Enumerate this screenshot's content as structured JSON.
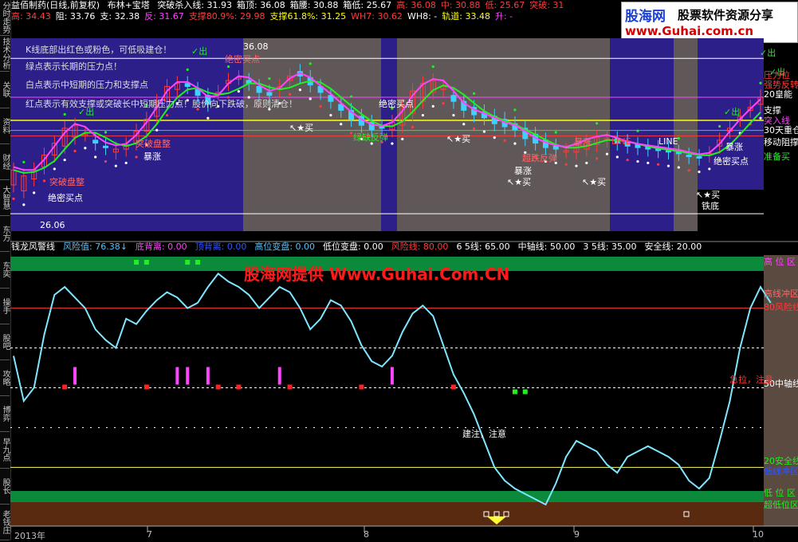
{
  "left_tabs": [
    "分时走势",
    "技术分析",
    "关联",
    "资料",
    "财经",
    "大智慧",
    "东方",
    "东奕",
    "操手",
    "股吧",
    "攻略",
    "博弈",
    "早九点",
    "股长",
    "老钱庄"
  ],
  "header": {
    "title": "益佰制药(日线,前复权)",
    "indicator": "布林+宝塔",
    "row1": [
      {
        "text": "突破杀入线: 31.93",
        "color": "#ffffff"
      },
      {
        "text": "箱顶: 36.08",
        "color": "#ffffff"
      },
      {
        "text": "箱腰: 30.88",
        "color": "#ffffff"
      },
      {
        "text": "箱低: 25.67",
        "color": "#ffffff"
      },
      {
        "text": "高: 36.08",
        "color": "#ff3b3b"
      },
      {
        "text": "中: 30.88",
        "color": "#ff3b3b"
      },
      {
        "text": "低: 25.67",
        "color": "#ff3b3b"
      },
      {
        "text": "突破: 31",
        "color": "#ff3b3b"
      }
    ],
    "row2": [
      {
        "text": "高: 34.43",
        "color": "#ff3b3b"
      },
      {
        "text": "阻: 33.76",
        "color": "#ffffff"
      },
      {
        "text": "支: 32.38",
        "color": "#ffffff"
      },
      {
        "text": "反: 31.67",
        "color": "#ff44ff"
      },
      {
        "text": "支撑80.9%: 29.98",
        "color": "#ff3b3b"
      },
      {
        "text": "支撑61.8%: 31.25",
        "color": "#ffff00"
      },
      {
        "text": "WH7: 30.62",
        "color": "#ff3b3b"
      },
      {
        "text": "WH8: -",
        "color": "#ffffff"
      },
      {
        "text": "轨道: 33.48",
        "color": "#ffff00"
      },
      {
        "text": "升: -",
        "color": "#ff44ff"
      }
    ]
  },
  "watermark": {
    "logo": "股海网",
    "tagline": "股票软件资源分享",
    "url": "www.Guhai.com.cn"
  },
  "upper": {
    "notes": [
      {
        "text": "K线底部出红色或粉色，可低吸建仓！",
        "color": "#ff3b3b"
      },
      {
        "text": "绿点表示长期的压力点！",
        "color": "#22ee22"
      },
      {
        "text": "白点表示中短期的压力和支撑点",
        "color": "#ffffff"
      },
      {
        "text": "红点表示有效支撑或突破长中短期压力点！股价向下跌破，原则清仓！",
        "color": "#ff3b3b"
      }
    ],
    "signals": [
      "绝密买点",
      "突破盘整",
      "绝密买点",
      "突破盘整",
      "暴涨",
      "绝密买点",
      "暴涨",
      "绿缺反弹",
      "超跌反弹",
      "暴涨",
      "暴涨",
      "绝密买点",
      "铁底",
      "↖★买",
      "↖★买",
      "↖★买",
      "↖★买",
      "↖★买",
      "✓出",
      "✓出",
      "✓出",
      "✓出",
      "✓出"
    ],
    "box_labels": [
      "36.08",
      "26.06"
    ],
    "line_labels": [
      "LINE",
      "LINE"
    ],
    "right_labels": [
      "压力位",
      "强势反转",
      "20皇能",
      "支撑",
      "突入线",
      "30天重仓",
      "移动阻撑",
      "准备买"
    ]
  },
  "lower": {
    "header": [
      {
        "text": "钱龙风警线",
        "color": "#ffffff"
      },
      {
        "text": "风险值: 76.38↓",
        "color": "#4fc3ff"
      },
      {
        "text": "底背离: 0.00",
        "color": "#ff44ff"
      },
      {
        "text": "顶背离: 0.00",
        "color": "#3355ff"
      },
      {
        "text": "高位变盘: 0.00",
        "color": "#4fc3ff"
      },
      {
        "text": "低位变盘: 0.00",
        "color": "#ffffff"
      },
      {
        "text": "风险线: 80.00",
        "color": "#ff3b3b"
      },
      {
        "text": "6 5线: 65.00",
        "color": "#ffffff"
      },
      {
        "text": "中轴线: 50.00",
        "color": "#ffffff"
      },
      {
        "text": "3 5线: 35.00",
        "color": "#ffffff"
      },
      {
        "text": "安全线: 20.00",
        "color": "#ffffff"
      }
    ],
    "promo": "股海网提供 Www.Guhai.Com.CN",
    "right_labels": [
      {
        "text": "高 位 区",
        "color": "#ff44ff"
      },
      {
        "text": "高线冲区",
        "color": "#ff6666"
      },
      {
        "text": "80风险线",
        "color": "#ff3b3b"
      },
      {
        "text": "50中轴线",
        "color": "#ffffff"
      },
      {
        "text": "20安全线",
        "color": "#22ee22"
      },
      {
        "text": "低线冲区",
        "color": "#3355ff"
      },
      {
        "text": "低 位 区",
        "color": "#22ee22"
      },
      {
        "text": "超低位区",
        "color": "#22ee22"
      }
    ],
    "notes": [
      {
        "text": "建注，注意",
        "color": "#ffffff"
      },
      {
        "text": "急拉，注意",
        "color": "#ff3b3b"
      }
    ]
  },
  "x_axis": [
    "2013年",
    "7",
    "8",
    "9",
    "10"
  ],
  "chart_data": [
    {
      "type": "line",
      "panel": "upper",
      "title": "益佰制药(日线,前复权) 布林+宝塔",
      "box_levels": {
        "top": 36.08,
        "mid": 30.88,
        "low": 25.67
      },
      "y_range": [
        24.5,
        38.5
      ],
      "series": [
        {
          "values": [
            27.6,
            27.2,
            28.0,
            28.8,
            29.6,
            30.2,
            30.8,
            31.0,
            30.6,
            30.2,
            29.8,
            30.0,
            30.4,
            31.2,
            32.2,
            33.2,
            34.0,
            34.4,
            34.0,
            33.6,
            33.8,
            34.4,
            34.8,
            34.6,
            34.2,
            33.8,
            34.0,
            34.6,
            35.2,
            34.8,
            34.2,
            33.6,
            33.0,
            32.6,
            32.2,
            31.8,
            31.5,
            31.3,
            31.6,
            32.4,
            33.2,
            33.8,
            34.0,
            33.6,
            33.2,
            32.8,
            32.5,
            32.2,
            32.0,
            31.7,
            31.4,
            31.0,
            30.6,
            30.2,
            29.9,
            29.8,
            30.0,
            30.3,
            30.6,
            30.7,
            30.5,
            30.3,
            30.2,
            30.1,
            30.0,
            29.8,
            29.6,
            29.5,
            29.6,
            30.2,
            31.2,
            32.0,
            32.6,
            33.0
          ]
        },
        {
          "values": [
            28.6,
            28.2,
            28.6,
            29.6,
            30.4,
            31.4,
            31.6,
            31.0,
            30.4,
            30.1,
            30.0,
            30.3,
            31.2,
            32.0,
            33.2,
            34.2,
            34.4,
            34.2,
            33.6,
            33.0,
            33.8,
            34.6,
            34.8,
            34.4,
            33.8,
            33.6,
            34.2,
            34.9,
            34.9,
            34.3,
            33.8,
            33.2,
            32.6,
            32.0,
            31.6,
            31.3,
            31.4,
            31.8,
            32.9,
            33.9,
            34.4,
            34.6,
            34.2,
            33.2,
            32.6,
            32.3,
            32.1,
            31.7,
            31.5,
            31.3,
            30.7,
            30.4,
            30.1,
            30.0,
            29.9,
            30.4,
            30.5,
            30.8,
            30.7,
            30.4,
            30.2,
            30.1,
            30.0,
            29.9,
            29.8,
            29.7,
            29.5,
            29.4,
            29.7,
            30.6,
            31.4,
            32.2,
            32.8,
            33.5
          ]
        }
      ]
    },
    {
      "type": "line",
      "panel": "lower",
      "title": "钱龙风警线",
      "y_range": [
        0,
        100
      ],
      "levels": {
        "risk": 80,
        "l65": 65,
        "mid": 50,
        "l35": 35,
        "safe": 20
      },
      "series": [
        {
          "name": "风险值",
          "values": [
            62,
            45,
            50,
            70,
            85,
            88,
            84,
            80,
            72,
            68,
            65,
            76,
            74,
            79,
            83,
            86,
            84,
            80,
            82,
            88,
            93,
            90,
            88,
            85,
            80,
            84,
            88,
            86,
            80,
            72,
            76,
            83,
            81,
            75,
            66,
            60,
            58,
            62,
            71,
            78,
            81,
            77,
            66,
            55,
            48,
            40,
            30,
            20,
            15,
            12,
            10,
            8,
            6,
            14,
            24,
            30,
            28,
            26,
            21,
            18,
            24,
            26,
            28,
            26,
            24,
            21,
            15,
            12,
            16,
            30,
            45,
            65,
            80,
            88,
            82
          ]
        }
      ]
    }
  ]
}
